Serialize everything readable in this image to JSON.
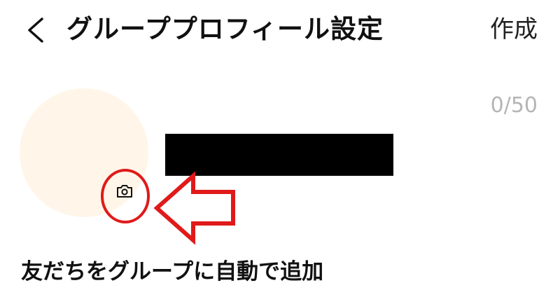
{
  "header": {
    "back_icon": "chevron-left-icon",
    "title": "グループプロフィール設定",
    "create_label": "作成"
  },
  "profile": {
    "avatar_color": "#fff6e9",
    "camera_icon": "camera-icon",
    "name_value": "",
    "name_counter": "0/50"
  },
  "annotation": {
    "color": "#e01a1a"
  },
  "settings": {
    "auto_add_label": "友だちをグループに自動で追加"
  }
}
